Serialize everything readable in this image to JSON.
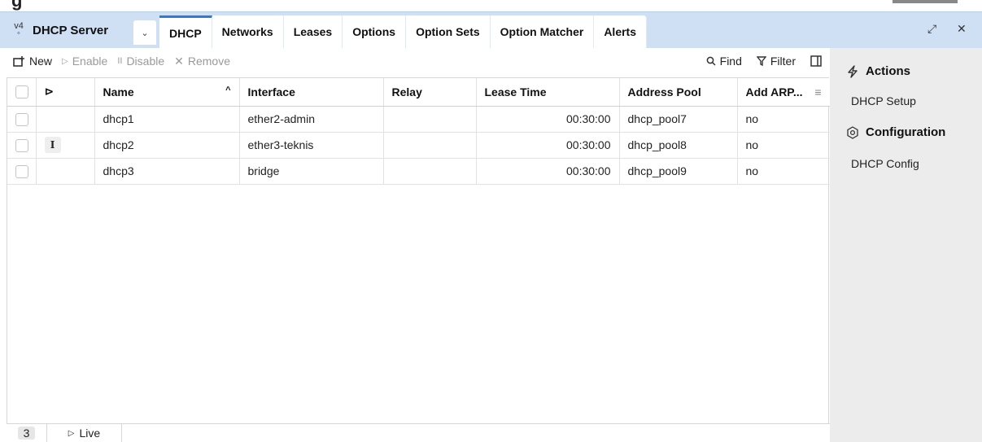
{
  "window": {
    "title": "DHCP Server",
    "app_icon": "dhcp-icon",
    "restore_glyph": "⤢",
    "close_glyph": "✕"
  },
  "tabs": [
    {
      "label": "DHCP",
      "active": true
    },
    {
      "label": "Networks"
    },
    {
      "label": "Leases"
    },
    {
      "label": "Options"
    },
    {
      "label": "Option Sets"
    },
    {
      "label": "Option Matcher"
    },
    {
      "label": "Alerts"
    }
  ],
  "toolbar": {
    "new_label": "New",
    "enable_label": "Enable",
    "disable_label": "Disable",
    "remove_label": "Remove",
    "find_label": "Find",
    "filter_label": "Filter"
  },
  "table": {
    "headers": {
      "name": "Name",
      "interface": "Interface",
      "relay": "Relay",
      "lease_time": "Lease Time",
      "address_pool": "Address Pool",
      "add_arp": "Add ARP..."
    },
    "rows": [
      {
        "flag": "",
        "name": "dhcp1",
        "interface": "ether2-admin",
        "relay": "",
        "lease_time": "00:30:00",
        "address_pool": "dhcp_pool7",
        "add_arp": "no"
      },
      {
        "flag": "I",
        "name": "dhcp2",
        "interface": "ether3-teknis",
        "relay": "",
        "lease_time": "00:30:00",
        "address_pool": "dhcp_pool8",
        "add_arp": "no"
      },
      {
        "flag": "",
        "name": "dhcp3",
        "interface": "bridge",
        "relay": "",
        "lease_time": "00:30:00",
        "address_pool": "dhcp_pool9",
        "add_arp": "no"
      }
    ]
  },
  "side_panel": {
    "actions_title": "Actions",
    "actions_items": [
      "DHCP Setup"
    ],
    "config_title": "Configuration",
    "config_items": [
      "DHCP Config"
    ]
  },
  "status": {
    "count": "3",
    "live_label": "Live"
  },
  "colors": {
    "tabbar_bg": "#cfe0f4",
    "active_tab_accent": "#2d7bd6",
    "side_panel_bg": "#ececec"
  }
}
